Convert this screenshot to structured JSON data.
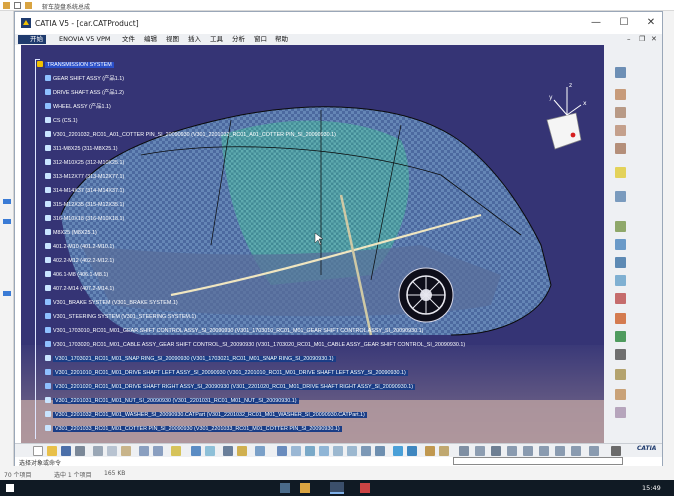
{
  "explorer": {
    "title": "斩车旋盘系统总成",
    "status_items": "70 个项目",
    "status_selected": "选中 1 个项目",
    "status_size": "165 KB",
    "clock": "15:49"
  },
  "window": {
    "title": "CATIA V5 - [car.CATProduct]",
    "minimize": "—",
    "maximize": "☐",
    "close": "✕"
  },
  "menu": {
    "start": "开始",
    "items": [
      "ENOVIA V5 VPM",
      "文件",
      "编辑",
      "视图",
      "插入",
      "工具",
      "分析",
      "窗口",
      "帮助"
    ],
    "window_controls": [
      "–",
      "❐",
      "✕"
    ]
  },
  "tree": {
    "root": "TRANSMISSION SYSTEM",
    "nodes": [
      "GEAR SHIFT ASSY (产品1.1)",
      "DRIVE SHAFT ASS (产品1.2)",
      "WHEEL ASSY (产品1.1)",
      "CS (CS.1)",
      "V301_2201032_RC01_A01_COTTER PIN_SI_20090930 (V301_2201032_RC01_A01_COTTER PIN_SI_20090930.1)",
      "311-M8X25 (311-M8X25.1)",
      "312-M10X25 (312-M10X25.1)",
      "313-M12X77 (313-M12X77.1)",
      "314-M14X37 (314-M14X37.1)",
      "315-M12X35 (315-M12X35.1)",
      "316-M10X18 (316-M10X18.1)",
      "M8X25 (M8X25.1)",
      "401.2-M10 (401.2-M10.1)",
      "402.2-M12 (402.2-M12.1)",
      "406.1-M8 (406.1-M8.1)",
      "407.2-M14 (407.2-M14.1)",
      "V301_BRAKE SYSTEM (V301_BRAKE SYSTEM.1)",
      "V301_STEERING SYSTEM (V301_STEERING SYSTEM.1)",
      "V301_1703010_RC01_M01_GEAR SHIFT CONTROL ASSY_SI_20090930 (V301_1703010_RC01_M01_GEAR SHIFT CONTROL ASSY_SI_20090930.1)",
      "V301_1703020_RC01_M01_CABLE ASSY_GEAR SHIFT CONTROL_SI_20090930 (V301_1703020_RC01_M01_CABLE ASSY_GEAR SHIFT CONTROL_SI_20090930.1)",
      "V301_1703021_RC01_M01_SNAP RING_SI_20090930 (V301_1703021_RC01_M01_SNAP RING_SI_20090930.1)",
      "V301_2201010_RC01_M01_DRIVE SHAFT LEFT ASSY_SI_20090930 (V301_2201010_RC01_M01_DRIVE SHAFT LEFT ASSY_SI_20090930.1)",
      "V301_2201020_RC01_M01_DRIVE SHAFT RIGHT ASSY_SI_20090930 (V301_2201020_RC01_M01_DRIVE SHAFT RIGHT ASSY_SI_20090930.1)",
      "V301_2201031_RC01_M01_NUT_SI_20090930 (V301_2201031_RC01_M01_NUT_SI_20090930.1)",
      "V301_2201032_RC01_M01_WASHER_SI_20090930.CATPart (V301_2201032_RC01_M01_WASHER_SI_20090930.CATPart.1)",
      "V301_2201033_RC01_M01_COTTER PIN_SI_20090930 (V301_2201033_RC01_M01_COTTER PIN_SI_20090930.1)"
    ]
  },
  "compass_labels": {
    "x": "x",
    "y": "y",
    "z": "z"
  },
  "bottom_status": "选择对象或命令",
  "brand": "CATIA",
  "colors": {
    "viewport": "#353475",
    "selection": "#2a4fc8",
    "accent": "#1f3b6e"
  }
}
